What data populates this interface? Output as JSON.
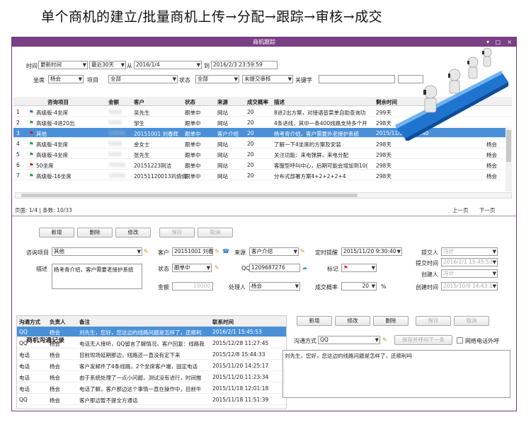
{
  "heading": "单个商机的建立/批量商机上传→分配→跟踪→审核→成交",
  "window": {
    "title": "商机跟踪",
    "controls": [
      "▾",
      "□",
      "×"
    ]
  },
  "filters": {
    "time_label": "时间",
    "time_type": "更新时间",
    "range": "最近30天",
    "from_label": "从",
    "from_date": "2016/1/4",
    "to_label": "到",
    "to_date": "2016/2/3 23:59:59",
    "seat_label": "坐席",
    "seat_value": "杨会",
    "project_label": "项目",
    "project_value": "全部",
    "status_label": "状态",
    "status_value": "全部",
    "audit_value": "未提交审核",
    "keyword_label": "关键字",
    "keyword_value": ""
  },
  "table": {
    "headers": [
      "咨询项目",
      "金额",
      "客户",
      "状态",
      "来源",
      "成交概率",
      "描述",
      "剩余时间"
    ],
    "rows": [
      {
        "no": "1",
        "flag": "blue",
        "project": "高级版-4坐席",
        "amount": "5000",
        "customer": "吴先生",
        "status": "跟单中",
        "source": "网站",
        "prob": "20",
        "desc": "8进2出方案，对接语音菜单自助查询功",
        "remain": "299天",
        "owner": ""
      },
      {
        "no": "2",
        "flag": "green",
        "project": "高级版-4进20出",
        "amount": "5000",
        "customer": "邹生",
        "status": "跟单中",
        "source": "网站",
        "prob": "20",
        "desc": "4条进线，其中一条400线路支持多个并",
        "remain": "298天",
        "owner": ""
      },
      {
        "no": "3",
        "flag": "red",
        "project": "其他",
        "amount": "10000",
        "customer": "20151001 刘春辉",
        "status": "跟单中",
        "source": "客户介绍",
        "prob": "20",
        "desc": "杨考青介绍，客户需要外老接护系统",
        "remain": "2015/11/20 9:30:40",
        "owner": ""
      },
      {
        "no": "4",
        "flag": "green",
        "project": "高级版-4坐席",
        "amount": "5000",
        "customer": "金女士",
        "status": "跟单中",
        "source": "网站",
        "prob": "20",
        "desc": "了解一下4坐席的方案及安装",
        "remain": "298天",
        "owner": "杨会"
      },
      {
        "no": "5",
        "flag": "green",
        "project": "高级版-4坐席",
        "amount": "5000",
        "customer": "张先生",
        "status": "跟单中",
        "source": "网站",
        "prob": "20",
        "desc": "关注功能：来电弹屏，来电分配",
        "remain": "298天",
        "owner": "杨会"
      },
      {
        "no": "6",
        "flag": "red",
        "project": "50坐席",
        "amount": "70000",
        "customer": "20151223荆洁",
        "status": "跟单中",
        "source": "网站",
        "prob": "20",
        "desc": "客服型呼叫中心，后期可能会增加到10(",
        "remain": "298天",
        "owner": "杨会"
      },
      {
        "no": "7",
        "flag": "green",
        "project": "高级版-16坐席",
        "amount": "10000",
        "customer": "20151120013巩倩倩",
        "status": "跟单中",
        "source": "网站",
        "prob": "20",
        "desc": "分布式部署方案4+2+2+2+4",
        "remain": "298天",
        "owner": "杨会"
      }
    ]
  },
  "pager": {
    "info": "页面: 1/4",
    "sep": "|",
    "count": "条数: 10/33",
    "prev": "上一页",
    "next": "下一页"
  },
  "actions": {
    "add": "新增",
    "delete": "删除",
    "edit": "修改",
    "save": "保存",
    "cancel": "取消"
  },
  "detail": {
    "project_label": "咨询项目",
    "project_value": "其他",
    "customer_label": "客户",
    "customer_value": "20151001 刘春辉",
    "source_label": "来源",
    "source_value": "客户介绍",
    "remind_label": "定时提醒",
    "remind_value": "2015/11/20 9:30:40",
    "submitter_label": "提交人",
    "submitter_value": "冯计",
    "desc_label": "描述",
    "desc_value": "杨考青介绍，客户需要老接护系统",
    "status_label": "状态",
    "status_value": "跟单中",
    "qq_label": "QQ",
    "qq_value": "1209687276",
    "mark_label": "标记",
    "submit_time_label": "提交时间",
    "submit_time_value": "2016/2/1 15:45:53",
    "creator_label": "创建人",
    "creator_value": "冯计",
    "amount_label": "金额",
    "amount_value": "10000",
    "handler_label": "处理人",
    "handler_value": "杨会",
    "prob_label": "成交概率",
    "prob_value": "20",
    "prob_unit": "%",
    "create_time_label": "创建时间",
    "create_time_value": "2015/10/9 14:43:1"
  },
  "comm": {
    "title": "商机沟通记录",
    "headers": [
      "沟通方式",
      "负责人",
      "备注",
      "联系时间"
    ],
    "rows": [
      {
        "way": "QQ",
        "owner": "杨会",
        "note": "刘先生，您好，您这边的线路问题是怎样了，还顺利",
        "time": "2016/2/1 15:45:53"
      },
      {
        "way": "QQ",
        "owner": "杨会",
        "note": "电话无人接听，QQ留言了解情况，客户回复：线路我",
        "time": "2015/12/28 11:27:45"
      },
      {
        "way": "电话",
        "owner": "杨会",
        "note": "目前现场延期那边，线路还一直没有定下来",
        "time": "2015/12/8 15:44:33"
      },
      {
        "way": "电话",
        "owner": "杨会",
        "note": "客户发邮件了4条线路，2个坐席客户端，固定电话",
        "time": "2015/11/20 14:25:17"
      },
      {
        "way": "电话",
        "owner": "杨会",
        "note": "由于系统处理了一点小问题，测试没有进行，时间推",
        "time": "2015/11/20 11:23:34"
      },
      {
        "way": "电话",
        "owner": "杨会",
        "note": "电话了解，客户那边这个事情一直在操作中，目前牛",
        "time": "2015/11/18 12:01:18"
      },
      {
        "way": "QQ",
        "owner": "杨会",
        "note": "客户那边暂不提全方通话",
        "time": "2015/11/18 11:51:39"
      }
    ],
    "way_label": "沟通方式",
    "way_value": "QQ",
    "save_next": "保存并呼叫下一条",
    "outbound_label": "网络电话外呼",
    "note_value": "刘先生，您好，您这边的线路问题是怎样了，还顺利吗"
  },
  "colors": {
    "titlebar": "#7b3f86",
    "selected": "#4a90d9",
    "accent": "#2c7fd0"
  }
}
